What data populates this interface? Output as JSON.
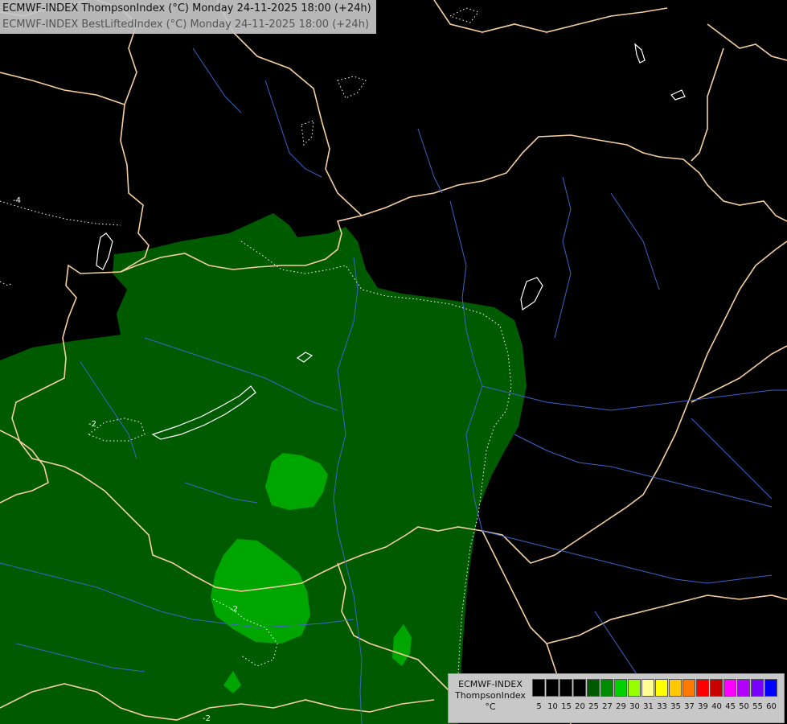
{
  "title": {
    "line1": "ECMWF-INDEX ThompsonIndex (°C) Monday 24-11-2025 18:00 (+24h)",
    "line2": "ECMWF-INDEX BestLiftedIndex (°C) Monday 24-11-2025 18:00 (+24h)"
  },
  "legend": {
    "model": "ECMWF-INDEX",
    "parameter": "ThompsonIndex",
    "unit": "°C",
    "swatches": [
      {
        "value": "5",
        "color": "#000000"
      },
      {
        "value": "10",
        "color": "#000000"
      },
      {
        "value": "15",
        "color": "#000000"
      },
      {
        "value": "20",
        "color": "#000000"
      },
      {
        "value": "25",
        "color": "#005a00"
      },
      {
        "value": "27",
        "color": "#008c00"
      },
      {
        "value": "29",
        "color": "#00d200"
      },
      {
        "value": "30",
        "color": "#96ff00"
      },
      {
        "value": "31",
        "color": "#ffff96"
      },
      {
        "value": "33",
        "color": "#ffff00"
      },
      {
        "value": "35",
        "color": "#ffc800"
      },
      {
        "value": "37",
        "color": "#ff7800"
      },
      {
        "value": "39",
        "color": "#ff0000"
      },
      {
        "value": "40",
        "color": "#c80000"
      },
      {
        "value": "45",
        "color": "#ff00ff"
      },
      {
        "value": "50",
        "color": "#b400ff"
      },
      {
        "value": "55",
        "color": "#7800ff"
      },
      {
        "value": "60",
        "color": "#0000ff"
      }
    ]
  },
  "map": {
    "background_color": "#000000",
    "border_color": "#f5cfa0",
    "river_color": "#3c64c8",
    "field_colors": {
      "level_25": "#005a00",
      "level_27": "#00a600"
    },
    "contour_labels": [
      "-4",
      "-2",
      "-2",
      "-2"
    ]
  }
}
